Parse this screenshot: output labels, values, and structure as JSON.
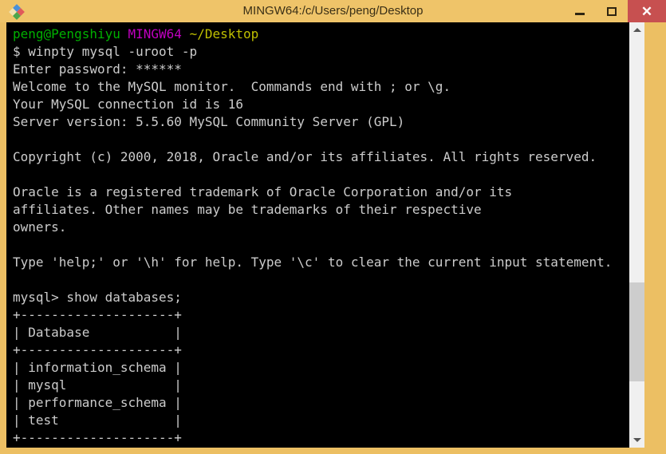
{
  "window": {
    "title": "MINGW64:/c/Users/peng/Desktop",
    "icon": "mintty-diamond-icon",
    "frame_color": "#efc469",
    "controls": {
      "minimize_label": "–",
      "maximize_label": "□",
      "close_label": "✕",
      "close_bg": "#c75050"
    }
  },
  "terminal": {
    "background": "#000000",
    "foreground": "#cccccc",
    "colors": {
      "green": "#00b000",
      "magenta": "#c000c0",
      "yellow": "#c0c000",
      "white": "#cccccc"
    },
    "prompt": {
      "user_host": "peng@Pengshiyu",
      "shell": "MINGW64",
      "path": "~/Desktop",
      "symbol": "$"
    },
    "lines": [
      {
        "segments": [
          {
            "text": "peng@Pengshiyu",
            "color": "green"
          },
          {
            "text": " ",
            "color": "white"
          },
          {
            "text": "MINGW64",
            "color": "magenta"
          },
          {
            "text": " ",
            "color": "white"
          },
          {
            "text": "~/Desktop",
            "color": "yellow"
          }
        ]
      },
      {
        "segments": [
          {
            "text": "$ winpty mysql -uroot -p",
            "color": "white"
          }
        ]
      },
      {
        "segments": [
          {
            "text": "Enter password: ******",
            "color": "white"
          }
        ]
      },
      {
        "segments": [
          {
            "text": "Welcome to the MySQL monitor.  Commands end with ; or \\g.",
            "color": "white"
          }
        ]
      },
      {
        "segments": [
          {
            "text": "Your MySQL connection id is 16",
            "color": "white"
          }
        ]
      },
      {
        "segments": [
          {
            "text": "Server version: 5.5.60 MySQL Community Server (GPL)",
            "color": "white"
          }
        ]
      },
      {
        "segments": [
          {
            "text": "",
            "color": "white"
          }
        ]
      },
      {
        "segments": [
          {
            "text": "Copyright (c) 2000, 2018, Oracle and/or its affiliates. All rights reserved.",
            "color": "white"
          }
        ]
      },
      {
        "segments": [
          {
            "text": "",
            "color": "white"
          }
        ]
      },
      {
        "segments": [
          {
            "text": "Oracle is a registered trademark of Oracle Corporation and/or its",
            "color": "white"
          }
        ]
      },
      {
        "segments": [
          {
            "text": "affiliates. Other names may be trademarks of their respective",
            "color": "white"
          }
        ]
      },
      {
        "segments": [
          {
            "text": "owners.",
            "color": "white"
          }
        ]
      },
      {
        "segments": [
          {
            "text": "",
            "color": "white"
          }
        ]
      },
      {
        "segments": [
          {
            "text": "Type 'help;' or '\\h' for help. Type '\\c' to clear the current input statement.",
            "color": "white"
          }
        ]
      },
      {
        "segments": [
          {
            "text": "",
            "color": "white"
          }
        ]
      },
      {
        "segments": [
          {
            "text": "mysql> show databases;",
            "color": "white"
          }
        ]
      },
      {
        "segments": [
          {
            "text": "+--------------------+",
            "color": "white"
          }
        ]
      },
      {
        "segments": [
          {
            "text": "| Database           |",
            "color": "white"
          }
        ]
      },
      {
        "segments": [
          {
            "text": "+--------------------+",
            "color": "white"
          }
        ]
      },
      {
        "segments": [
          {
            "text": "| information_schema |",
            "color": "white"
          }
        ]
      },
      {
        "segments": [
          {
            "text": "| mysql              |",
            "color": "white"
          }
        ]
      },
      {
        "segments": [
          {
            "text": "| performance_schema |",
            "color": "white"
          }
        ]
      },
      {
        "segments": [
          {
            "text": "| test               |",
            "color": "white"
          }
        ]
      },
      {
        "segments": [
          {
            "text": "+--------------------+",
            "color": "white"
          }
        ]
      }
    ],
    "query": "show databases;",
    "result_table": {
      "columns": [
        "Database"
      ],
      "rows": [
        [
          "information_schema"
        ],
        [
          "mysql"
        ],
        [
          "performance_schema"
        ],
        [
          "test"
        ]
      ]
    },
    "mysql_info": {
      "connection_id": "16",
      "server_version": "5.5.60 MySQL Community Server (GPL)",
      "password_mask": "******",
      "command": "winpty mysql -uroot -p"
    }
  },
  "scrollbar": {
    "up_arrow": "scroll-up-arrow",
    "down_arrow": "scroll-down-arrow",
    "thumb_top_pct": 62,
    "thumb_height_pct": 25
  }
}
